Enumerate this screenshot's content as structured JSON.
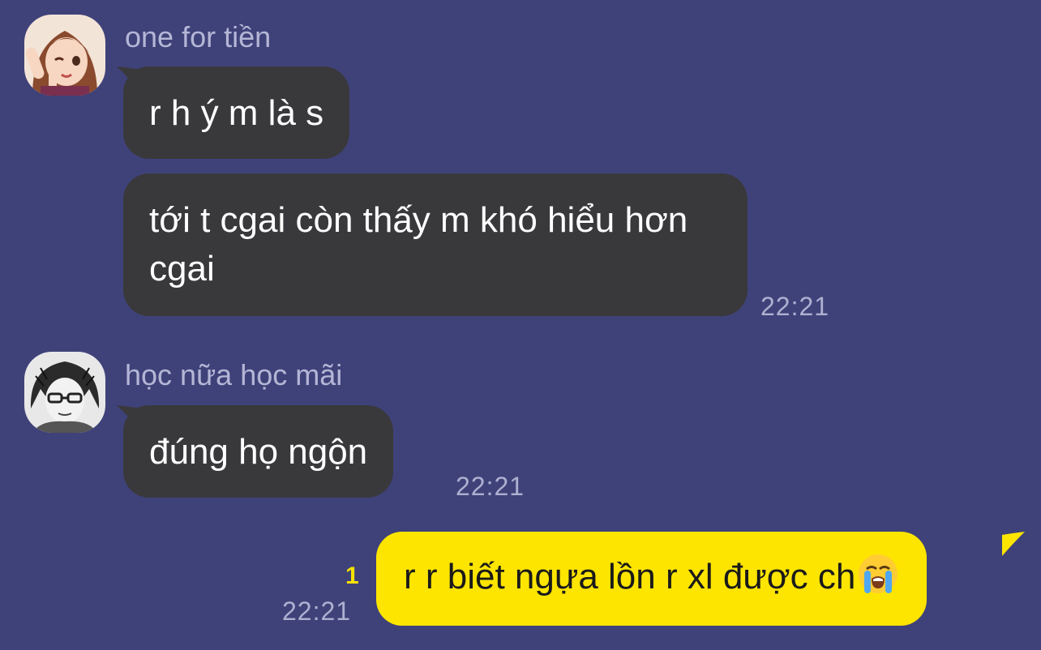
{
  "messages": [
    {
      "sender": "one for tiền",
      "bubbles": [
        "r h ý m là s",
        "tới t cgai còn thấy m khó hiểu hơn cgai"
      ],
      "time": "22:21"
    },
    {
      "sender": "học nữa học mãi",
      "bubbles": [
        "đúng họ ngộn"
      ],
      "time": "22:21"
    }
  ],
  "my_message": {
    "text": "r r biết ngựa lồn r xl được ch",
    "emoji": "loudly-crying-face",
    "unread_count": "1",
    "time": "22:21"
  },
  "colors": {
    "background": "#3f4279",
    "incoming_bubble": "#39393c",
    "outgoing_bubble": "#fee500",
    "unread": "#f4e200"
  }
}
